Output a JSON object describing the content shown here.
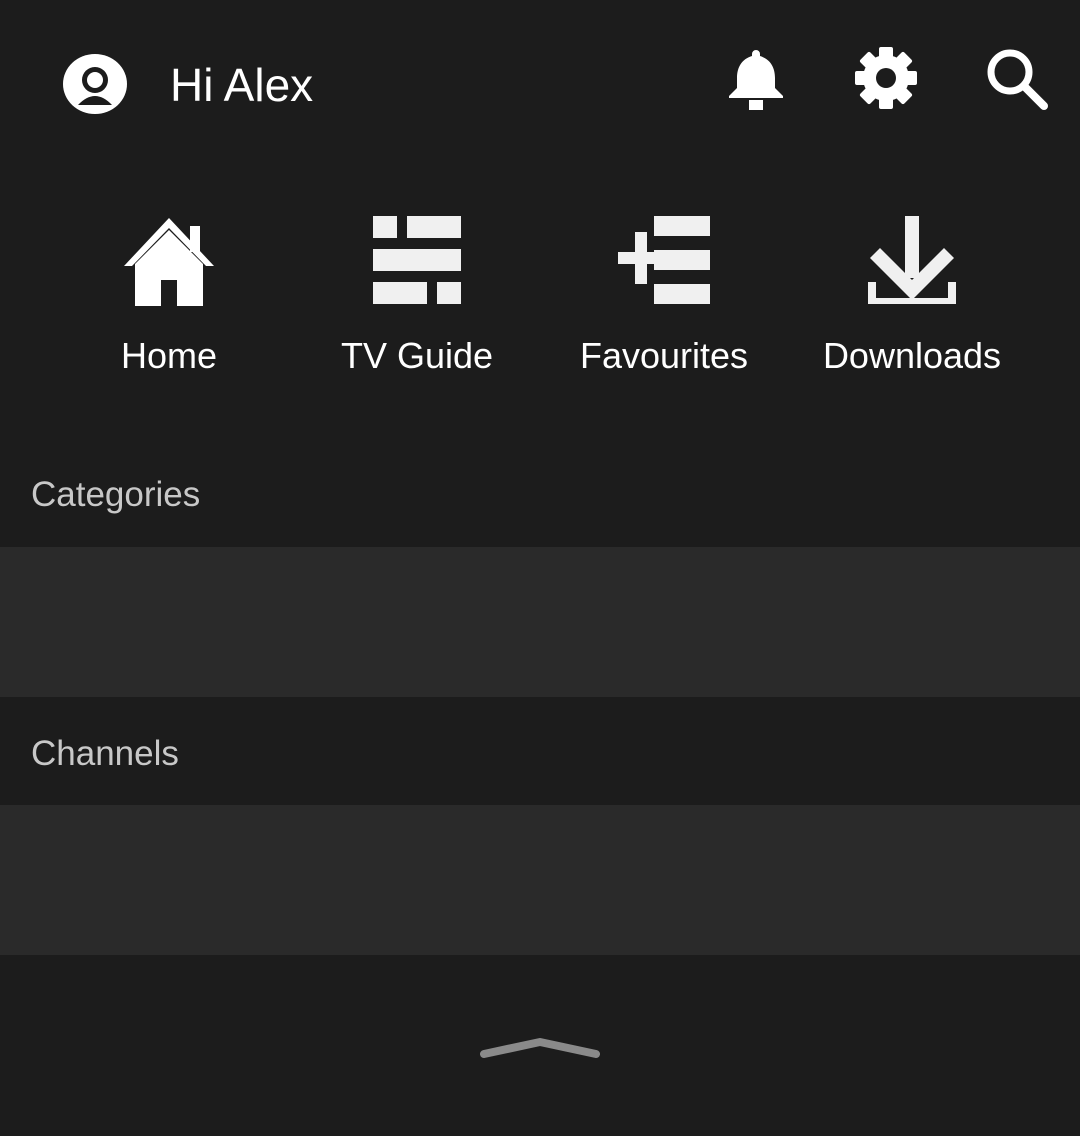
{
  "header": {
    "greeting": "Hi Alex",
    "avatar_icon": "account-circle-icon",
    "notifications_icon": "bell-icon",
    "settings_icon": "gear-icon",
    "search_icon": "search-icon"
  },
  "nav": {
    "items": [
      {
        "label": "Home",
        "icon": "home-icon"
      },
      {
        "label": "TV Guide",
        "icon": "tv-guide-icon"
      },
      {
        "label": "Favourites",
        "icon": "playlist-add-icon"
      },
      {
        "label": "Downloads",
        "icon": "download-icon"
      }
    ]
  },
  "sections": {
    "categories": {
      "title": "Categories"
    },
    "channels": {
      "title": "Channels"
    }
  },
  "bottom": {
    "handle_icon": "chevron-up-icon"
  },
  "colors": {
    "background": "#1c1c1c",
    "strip": "#2a2a2a",
    "icon": "#ffffff",
    "section_text": "#c8c8c8",
    "handle": "#8a8a8a"
  }
}
